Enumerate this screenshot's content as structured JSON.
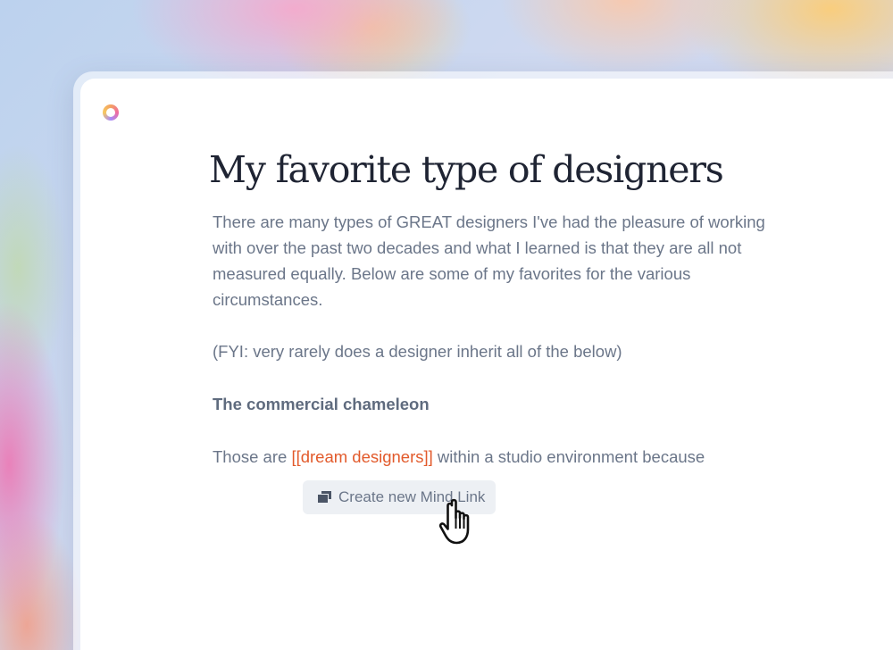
{
  "document": {
    "title": "My favorite type of designers",
    "intro": "There are many types of GREAT designers I've had the pleasure of working with over the past two decades and what I learned is that they are all not measured equally. Below are some of my favorites for the various circumstances.",
    "fyi": "(FYI: very rarely does a designer inherit all of the below)",
    "section_heading": "The commercial chameleon",
    "body_prefix": "Those are ",
    "mind_link": "[[dream designers]]",
    "body_suffix": " within a studio environment because"
  },
  "popup": {
    "create_mind_link_label": "Create new Mind Link",
    "icon": "mind-link-icon"
  },
  "cursor": {
    "icon": "hand-pointer-icon"
  },
  "colors": {
    "link": "#e25a2b",
    "body_text": "#6b7689",
    "title_text": "#1f2433",
    "button_bg": "#edf0f4"
  }
}
